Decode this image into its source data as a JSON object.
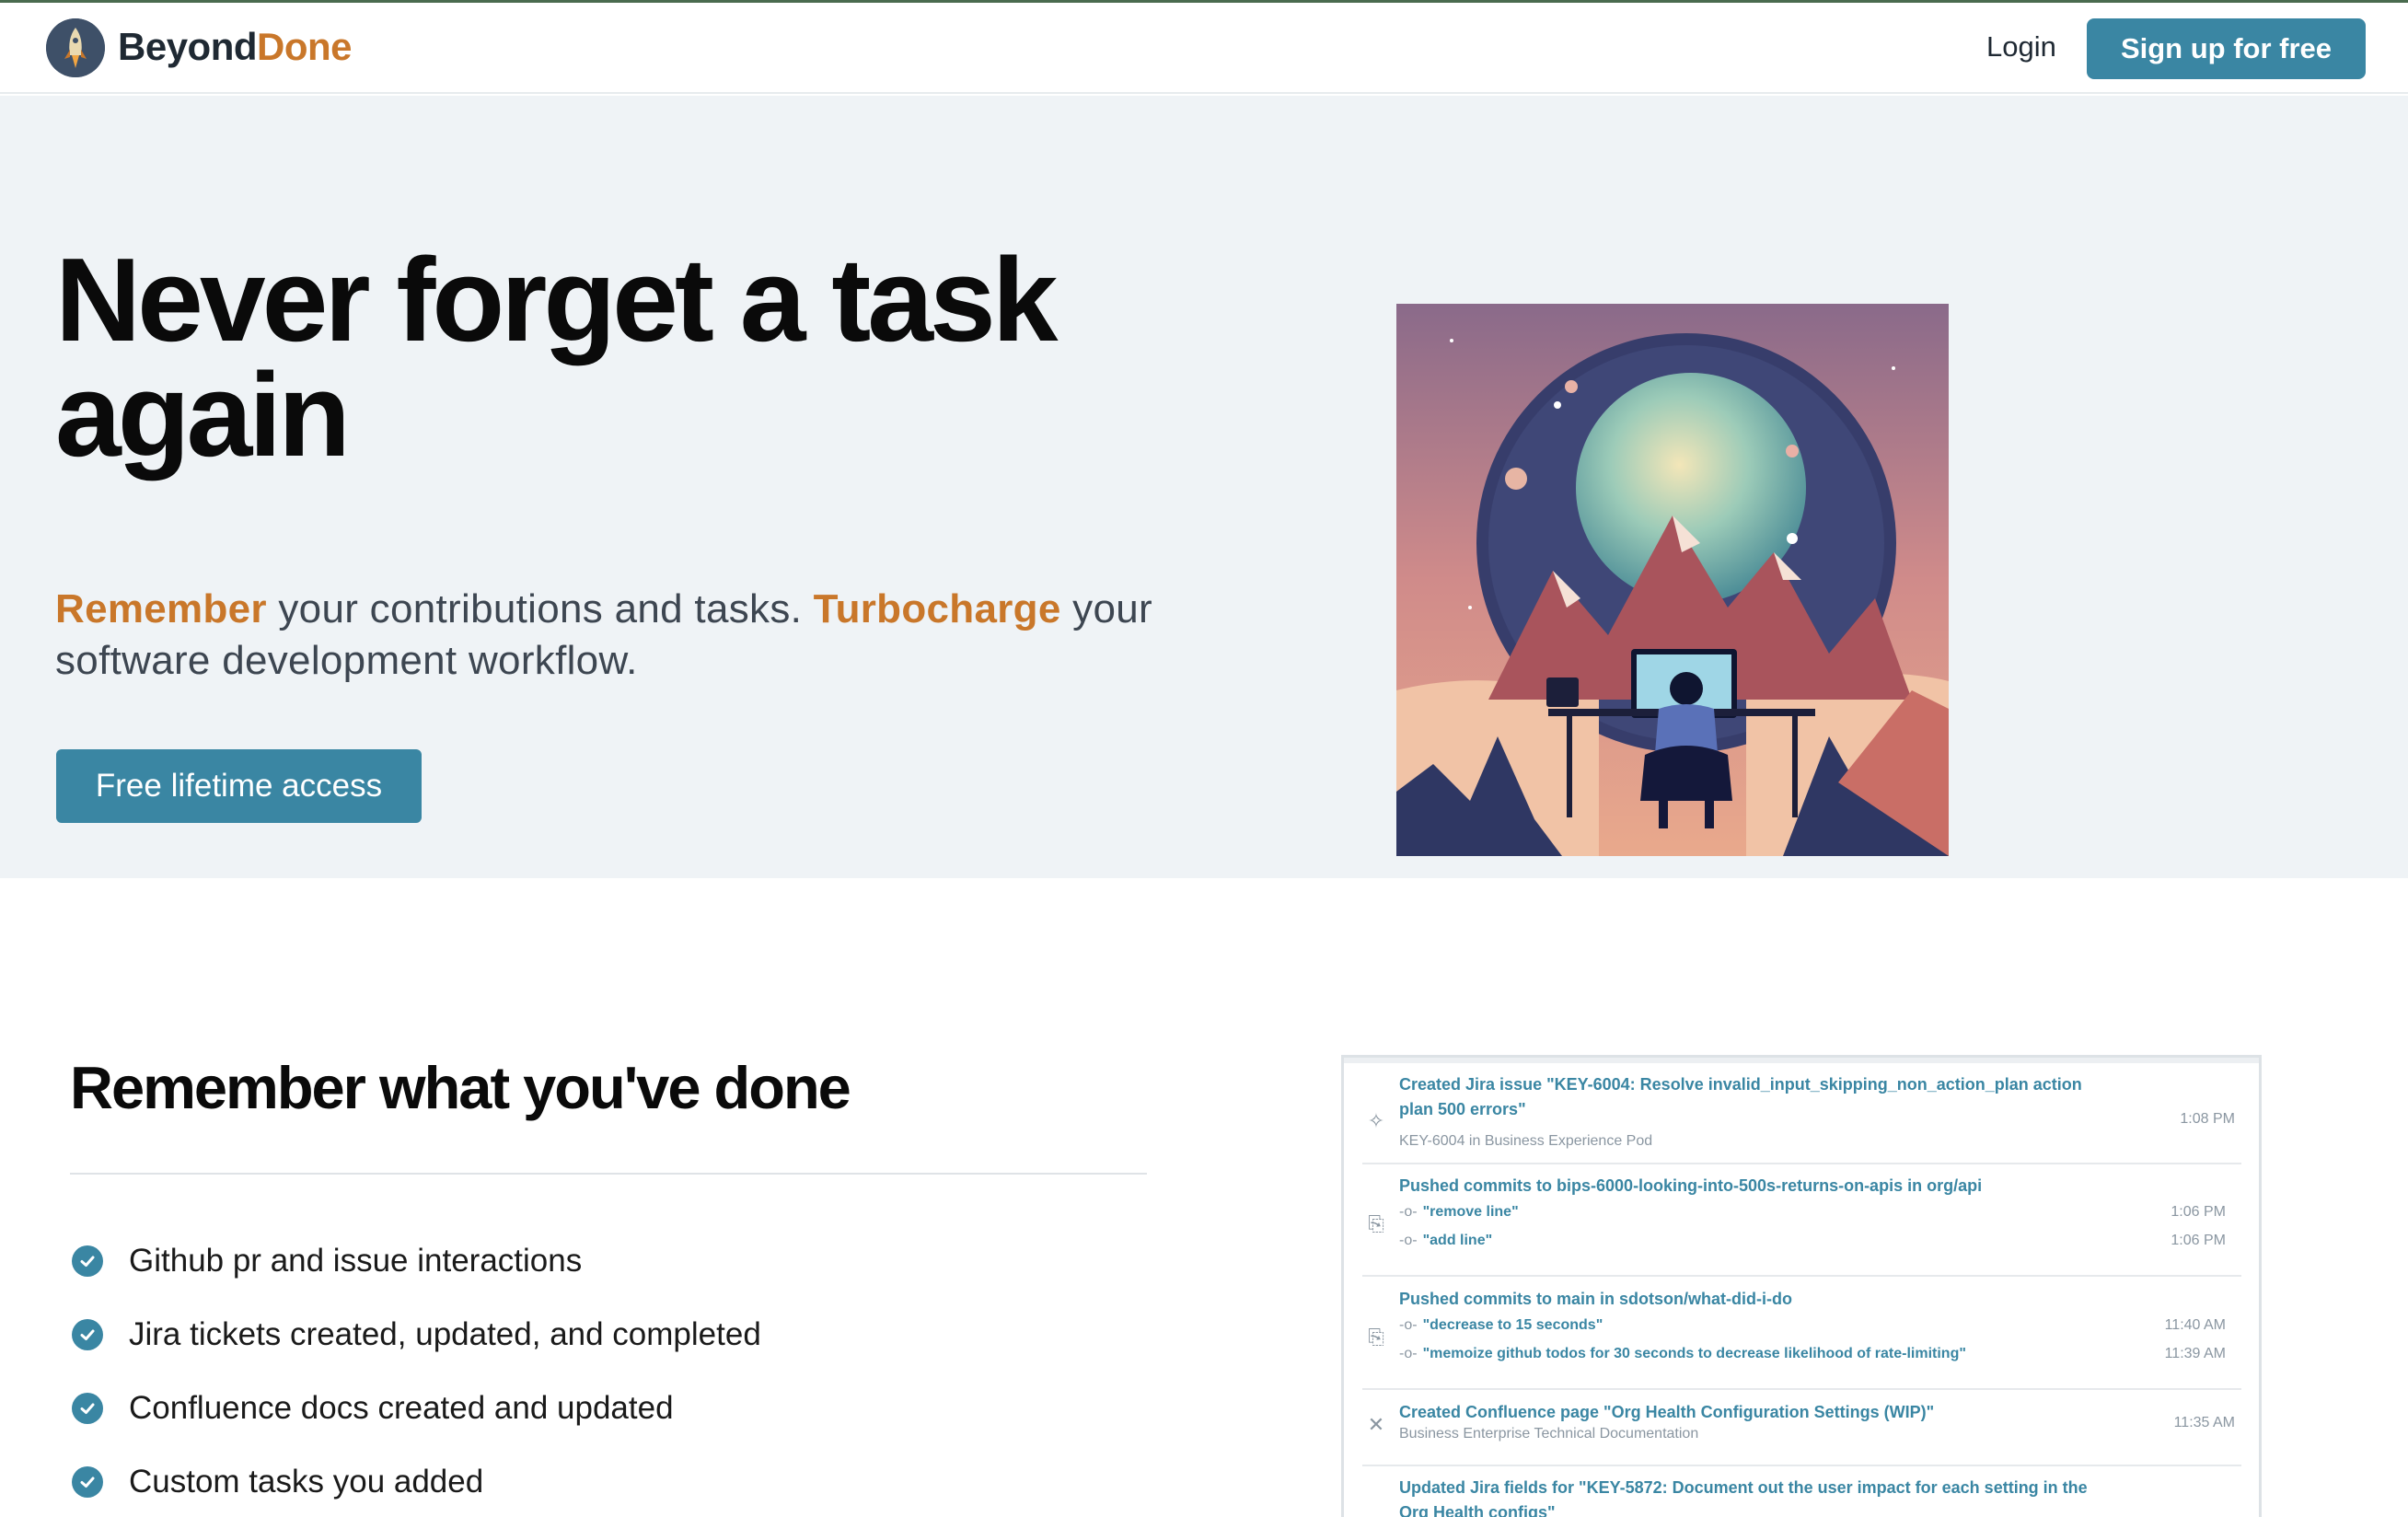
{
  "nav": {
    "brand_part1": "Beyond",
    "brand_part2": "Done",
    "login": "Login",
    "signup": "Sign up for free"
  },
  "hero": {
    "title_line1": "Never forget a task",
    "title_line2": "again",
    "sub_accent1": "Remember",
    "sub_text1": " your contributions and tasks. ",
    "sub_accent2": "Turbocharge",
    "sub_text2": " your software development workflow.",
    "cta": "Free lifetime access"
  },
  "section": {
    "title": "Remember what you've done",
    "features": [
      "Github pr and issue interactions",
      "Jira tickets created, updated, and completed",
      "Confluence docs created and updated",
      "Custom tasks you added"
    ]
  },
  "activity": [
    {
      "icon": "jira-icon",
      "title": "Created Jira issue \"KEY-6004: Resolve invalid_input_skipping_non_action_plan action plan 500 errors\"",
      "meta": "KEY-6004 in Business Experience Pod",
      "time": "1:08 PM"
    },
    {
      "icon": "push-icon",
      "title": "Pushed commits to bips-6000-looking-into-500s-returns-on-apis in org/api",
      "commits": [
        {
          "msg": "\"remove line\"",
          "time": "1:06 PM"
        },
        {
          "msg": "\"add line\"",
          "time": "1:06 PM"
        }
      ]
    },
    {
      "icon": "push-icon",
      "title": "Pushed commits to main in sdotson/what-did-i-do",
      "commits": [
        {
          "msg": "\"decrease to 15 seconds\"",
          "time": "11:40 AM"
        },
        {
          "msg": "\"memoize github todos for 30 seconds to decrease likelihood of rate-limiting\"",
          "time": "11:39 AM"
        }
      ]
    },
    {
      "icon": "confluence-icon",
      "title": "Created Confluence page \"Org Health Configuration Settings (WIP)\"",
      "meta": "Business Enterprise Technical Documentation",
      "time": "11:35 AM"
    },
    {
      "icon": "jira-icon",
      "title": "Updated Jira fields for \"KEY-5872: Document out the user impact for each setting in the Org Health configs\""
    }
  ]
}
